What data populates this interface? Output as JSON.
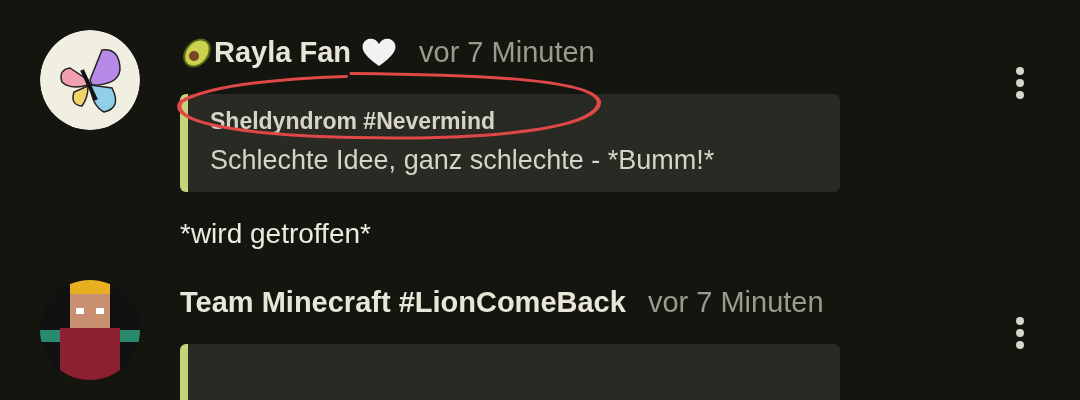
{
  "comments": [
    {
      "avatar": {
        "kind": "butterfly"
      },
      "emoji_before": {
        "kind": "avocado"
      },
      "author": "Rayla Fan",
      "emoji_after": {
        "kind": "heart"
      },
      "time": "vor 7 Minuten",
      "quote": {
        "title": "Sheldyndrom #Nevermind",
        "text": "Schlechte Idee, ganz schlechte - *Bumm!*",
        "circled": true,
        "kind": "text"
      },
      "body": "*wird getroffen*"
    },
    {
      "avatar": {
        "kind": "pixel"
      },
      "author": "Team Minecraft #LionComeBack",
      "time": "vor 7 Minuten",
      "quote": {
        "kind": "blank"
      }
    }
  ]
}
